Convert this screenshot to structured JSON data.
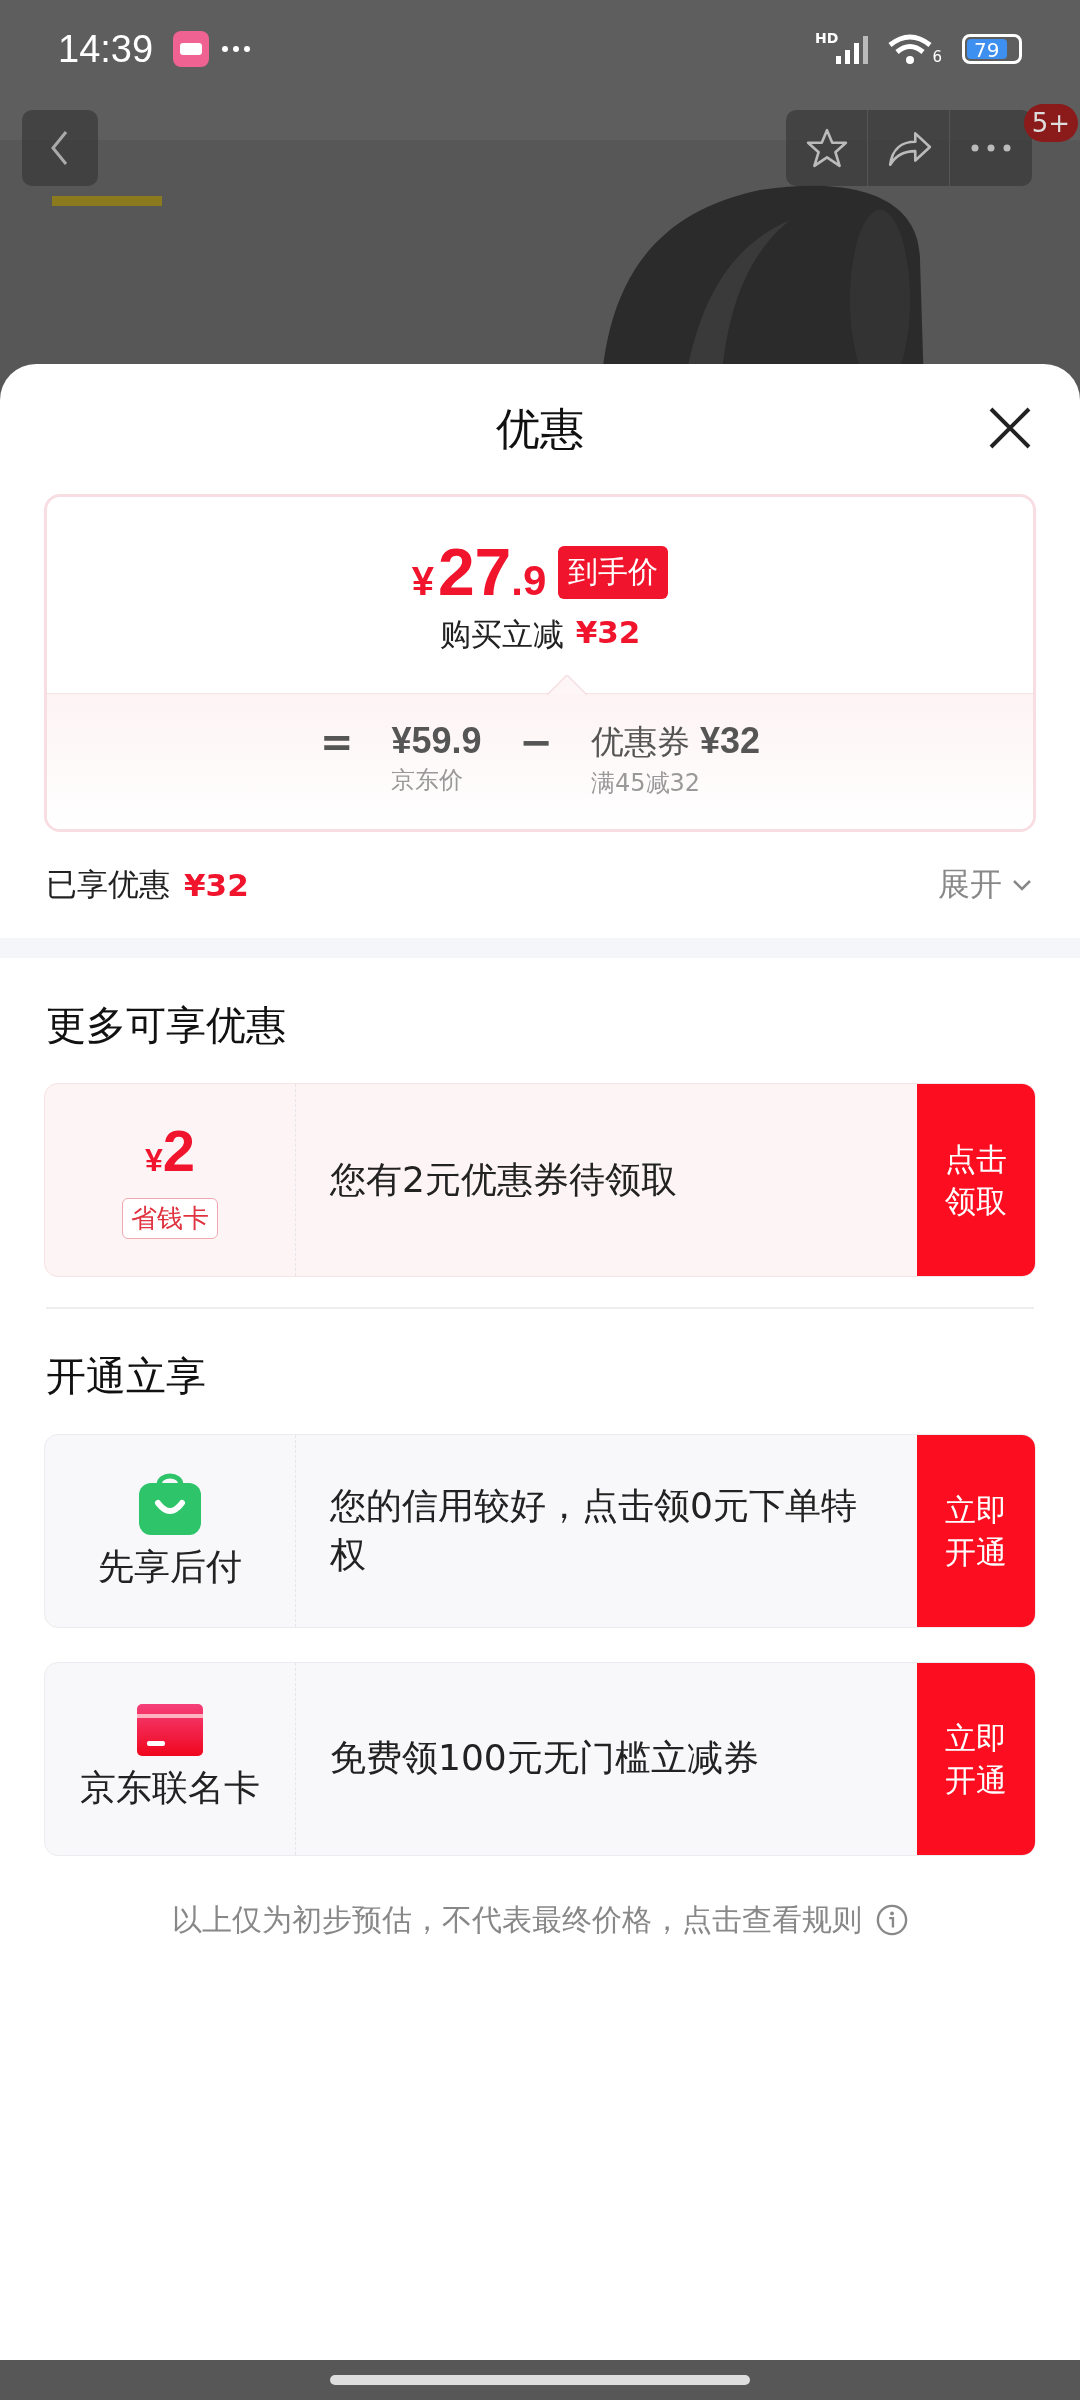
{
  "status_bar": {
    "time": "14:39",
    "signal_label": "HD",
    "wifi_label": "6",
    "battery": "79"
  },
  "top_bar": {
    "badge": "5+"
  },
  "sheet": {
    "title": "优惠",
    "price_card": {
      "currency": "¥",
      "price_int": "27",
      "price_dec": ".9",
      "price_tag": "到手价",
      "reduce_label": "购买立减",
      "reduce_amount": "¥32",
      "breakdown": [
        {
          "kind": "operator",
          "text": "="
        },
        {
          "kind": "term",
          "amount": "¥59.9",
          "caption": "京东价"
        },
        {
          "kind": "operator",
          "text": "−"
        },
        {
          "kind": "term",
          "label": "优惠券",
          "amount": "¥32",
          "caption": "满45减32"
        }
      ]
    },
    "enjoyed": {
      "label": "已享优惠",
      "amount": "¥32",
      "expand": "展开"
    },
    "sections": [
      {
        "title": "更多可享优惠",
        "offers": [
          {
            "kind": "coupon",
            "currency": "¥",
            "amount": "2",
            "tag": "省钱卡",
            "text": "您有2元优惠券待领取",
            "action": "点击领取"
          }
        ]
      },
      {
        "title": "开通立享",
        "offers": [
          {
            "kind": "paylater",
            "name": "先享后付",
            "text": "您的信用较好，点击领0元下单特权",
            "action": "立即开通"
          },
          {
            "kind": "cobrand",
            "name": "京东联名卡",
            "text": "免费领100元无门槛立减券",
            "action": "立即开通"
          }
        ]
      }
    ],
    "footer": "以上仅为初步预估，不代表最终价格，点击查看规则"
  }
}
